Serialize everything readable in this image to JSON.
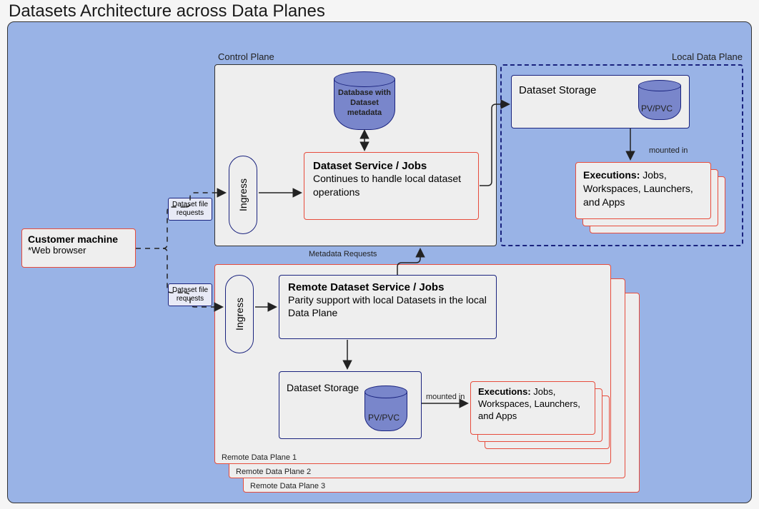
{
  "title": "Datasets Architecture across Data Planes",
  "customer": {
    "title": "Customer machine",
    "sub": "*Web browser"
  },
  "req_label_top": "Dataset file requests",
  "req_label_bottom": "Dataset file requests",
  "control_plane": {
    "label": "Control Plane",
    "ingress": "Ingress",
    "db_label": "Database with Dataset metadata",
    "service_title": "Dataset Service / Jobs",
    "service_sub": "Continues to handle local dataset operations",
    "metadata_requests": "Metadata Requests"
  },
  "local_plane": {
    "label": "Local Data Plane",
    "storage": "Dataset Storage",
    "disk": "PV/PVC",
    "mounted": "mounted in",
    "exec_title": "Executions:",
    "exec_sub": " Jobs, Workspaces, Launchers, and Apps"
  },
  "remote_plane": {
    "labels": [
      "Remote Data Plane 1",
      "Remote Data Plane 2",
      "Remote Data Plane 3"
    ],
    "ingress": "Ingress",
    "service_title": "Remote Dataset Service / Jobs",
    "service_sub": "Parity support with local Datasets in the local Data Plane",
    "storage": "Dataset Storage",
    "disk": "PV/PVC",
    "mounted": "mounted in",
    "exec_title": "Executions:",
    "exec_sub": " Jobs, Workspaces, Launchers, and Apps"
  }
}
